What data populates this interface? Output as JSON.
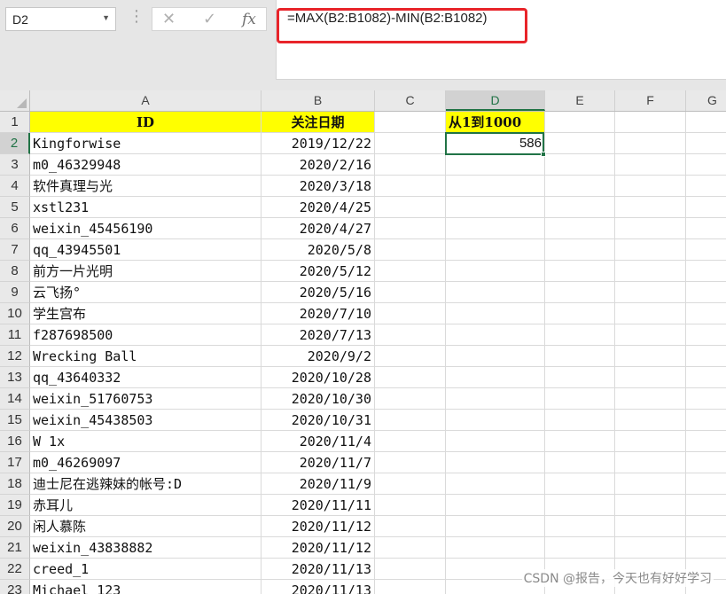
{
  "formula_bar": {
    "name_box": "D2",
    "more_icon": "⋮",
    "cancel_icon": "✕",
    "enter_icon": "✓",
    "fx_label": "fx",
    "formula": "=MAX(B2:B1082)-MIN(B2:B1082)"
  },
  "sheet": {
    "columns": [
      "A",
      "B",
      "C",
      "D",
      "E",
      "F",
      "G"
    ],
    "active_column": "D",
    "active_row": 2,
    "header": {
      "A": "ID",
      "B": "关注日期",
      "D": "从1到1000"
    },
    "rows": [
      {
        "num": "1"
      },
      {
        "num": "2",
        "A": "Kingforwise",
        "B": "2019/12/22",
        "D": "586"
      },
      {
        "num": "3",
        "A": "m0_46329948",
        "B": "2020/2/16"
      },
      {
        "num": "4",
        "A": "软件真理与光",
        "B": "2020/3/18"
      },
      {
        "num": "5",
        "A": "xstl231",
        "B": "2020/4/25"
      },
      {
        "num": "6",
        "A": "weixin_45456190",
        "B": "2020/4/27"
      },
      {
        "num": "7",
        "A": "qq_43945501",
        "B": "2020/5/8"
      },
      {
        "num": "8",
        "A": "前方一片光明",
        "B": "2020/5/12"
      },
      {
        "num": "9",
        "A": "云飞扬°",
        "B": "2020/5/16"
      },
      {
        "num": "10",
        "A": "学生宫布",
        "B": "2020/7/10"
      },
      {
        "num": "11",
        "A": "f287698500",
        "B": "2020/7/13"
      },
      {
        "num": "12",
        "A": "Wrecking Ball",
        "B": "2020/9/2"
      },
      {
        "num": "13",
        "A": "qq_43640332",
        "B": "2020/10/28"
      },
      {
        "num": "14",
        "A": "weixin_51760753",
        "B": "2020/10/30"
      },
      {
        "num": "15",
        "A": "weixin_45438503",
        "B": "2020/10/31"
      },
      {
        "num": "16",
        "A": "W 1x",
        "B": "2020/11/4"
      },
      {
        "num": "17",
        "A": "m0_46269097",
        "B": "2020/11/7"
      },
      {
        "num": "18",
        "A": "迪士尼在逃辣妹的帐号:D",
        "B": "2020/11/9"
      },
      {
        "num": "19",
        "A": "赤耳儿",
        "B": "2020/11/11"
      },
      {
        "num": "20",
        "A": "闲人慕陈",
        "B": "2020/11/12"
      },
      {
        "num": "21",
        "A": "weixin_43838882",
        "B": "2020/11/12"
      },
      {
        "num": "22",
        "A": "creed_1",
        "B": "2020/11/13"
      },
      {
        "num": "23",
        "A": "Michael_123",
        "B": "2020/11/13"
      }
    ]
  },
  "watermark": "CSDN @报告，今天也有好好学习",
  "colors": {
    "header_fill": "#ffff00",
    "selection": "#217346",
    "highlight_box": "#e8242a"
  }
}
